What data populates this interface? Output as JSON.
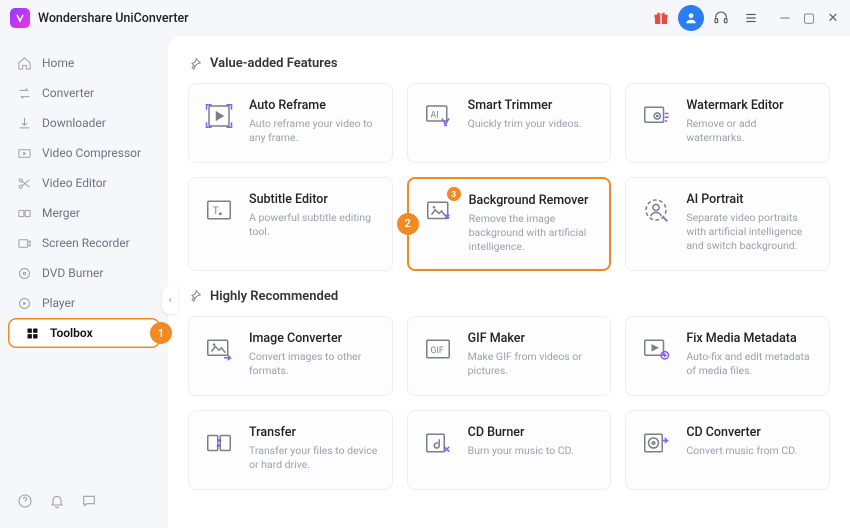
{
  "header": {
    "title": "Wondershare UniConverter"
  },
  "sidebar": {
    "items": [
      {
        "label": "Home",
        "icon": "home-icon"
      },
      {
        "label": "Converter",
        "icon": "convert-icon"
      },
      {
        "label": "Downloader",
        "icon": "download-icon"
      },
      {
        "label": "Video Compressor",
        "icon": "compress-icon"
      },
      {
        "label": "Video Editor",
        "icon": "scissors-icon"
      },
      {
        "label": "Merger",
        "icon": "merge-icon"
      },
      {
        "label": "Screen Recorder",
        "icon": "record-icon"
      },
      {
        "label": "DVD Burner",
        "icon": "disc-icon"
      },
      {
        "label": "Player",
        "icon": "play-icon"
      },
      {
        "label": "Toolbox",
        "icon": "grid-icon",
        "active": true,
        "badge": "1"
      }
    ]
  },
  "sections": [
    {
      "title": "Value-added Features",
      "cards": [
        {
          "title": "Auto Reframe",
          "desc": "Auto reframe your video to any frame."
        },
        {
          "title": "Smart Trimmer",
          "desc": "Quickly trim your videos."
        },
        {
          "title": "Watermark Editor",
          "desc": "Remove or add watermarks."
        },
        {
          "title": "Subtitle Editor",
          "desc": "A powerful subtitle editing tool."
        },
        {
          "title": "Background Remover",
          "desc": "Remove the image background with artificial intelligence.",
          "highlight": true,
          "hl_badge": "2",
          "mini_badge": "3"
        },
        {
          "title": "AI Portrait",
          "desc": "Separate video portraits with artificial intelligence and switch background."
        }
      ]
    },
    {
      "title": "Highly Recommended",
      "cards": [
        {
          "title": "Image Converter",
          "desc": "Convert images to other formats."
        },
        {
          "title": "GIF Maker",
          "desc": "Make GIF from videos or pictures."
        },
        {
          "title": "Fix Media Metadata",
          "desc": "Auto-fix and edit metadata of media files."
        },
        {
          "title": "Transfer",
          "desc": "Transfer your files to device or hard drive."
        },
        {
          "title": "CD Burner",
          "desc": "Burn your music to CD."
        },
        {
          "title": "CD Converter",
          "desc": "Convert music from CD."
        }
      ]
    }
  ]
}
